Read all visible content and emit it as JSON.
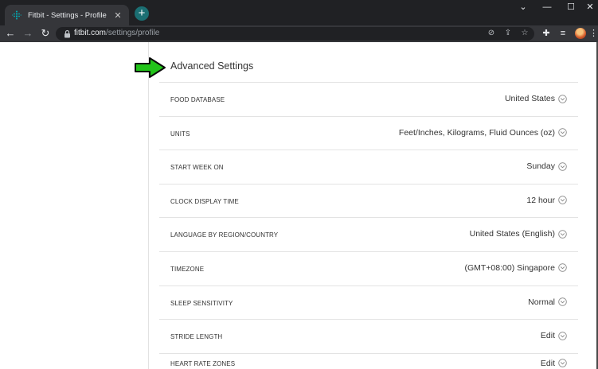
{
  "browser": {
    "tab_title": "Fitbit - Settings - Profile",
    "new_tab_label": "+",
    "url_host": "fitbit.com",
    "url_path": "/settings/profile"
  },
  "page": {
    "section_title": "Advanced Settings",
    "settings": [
      {
        "label": "FOOD DATABASE",
        "value": "United States"
      },
      {
        "label": "UNITS",
        "value": "Feet/Inches, Kilograms, Fluid Ounces (oz)"
      },
      {
        "label": "START WEEK ON",
        "value": "Sunday"
      },
      {
        "label": "CLOCK DISPLAY TIME",
        "value": "12 hour"
      },
      {
        "label": "LANGUAGE BY REGION/COUNTRY",
        "value": "United States (English)"
      },
      {
        "label": "TIMEZONE",
        "value": "(GMT+08:00) Singapore"
      },
      {
        "label": "SLEEP SENSITIVITY",
        "value": "Normal"
      },
      {
        "label": "STRIDE LENGTH",
        "value": "Edit"
      },
      {
        "label": "HEART RATE ZONES",
        "value": "Edit"
      }
    ]
  },
  "colors": {
    "arrow": "#22c41a",
    "favicon": "#00b0b9",
    "chrome_dark": "#202124",
    "chrome_toolbar": "#35363a"
  }
}
